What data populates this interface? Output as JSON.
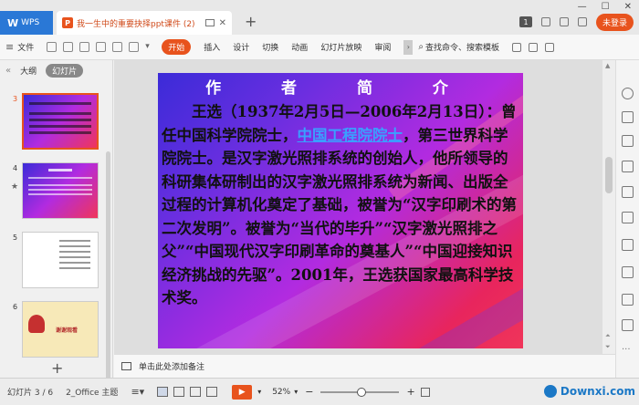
{
  "titlebar": {
    "app_tab": "WPS",
    "doc_tab": "我一生中的重要抉择ppt课件 (2)",
    "login": "未登录",
    "badge": "1",
    "new_tab": "+"
  },
  "ribbon": {
    "file": "文件",
    "start": "开始",
    "tabs": [
      "插入",
      "设计",
      "切换",
      "动画",
      "幻灯片放映",
      "审阅"
    ],
    "search": "查找命令、搜索模板"
  },
  "leftpanel": {
    "outline_tab": "大纲",
    "slides_tab": "幻灯片",
    "thumbs": [
      {
        "num": "3",
        "active": true
      },
      {
        "num": "4",
        "active": false
      },
      {
        "num": "5",
        "active": false
      },
      {
        "num": "6",
        "active": false
      }
    ],
    "thumb6_text": "谢谢观看"
  },
  "slide": {
    "title": "作 者 简 介",
    "body_pre": "王选（1937年2月5日—2006年2月13日）：曾任中国科学院院士，",
    "body_link": "中国工程院院士",
    "body_post": "，第三世界科学院院士。是汉字激光照排系统的创始人，他所领导的科研集体研制出的汉字激光照排系统为新闻、出版全过程的计算机化奠定了基础，被誉为“汉字印刷术的第二次发明”。被誉为“当代的毕升”“汉字激光照排之父”“中国现代汉字印刷革命的奠基人”“中国迎接知识经济挑战的先驱”。2001年，王选获国家最高科学技术奖。"
  },
  "notes": {
    "placeholder": "单击此处添加备注"
  },
  "statusbar": {
    "slide_count": "幻灯片 3 / 6",
    "theme": "2_Office 主题",
    "zoom": "52%",
    "zoom_value": 0.52
  },
  "watermark": "Downxi.com",
  "colors": {
    "accent": "#e8531d",
    "slide_gradient_start": "#3b2bd8",
    "slide_gradient_end": "#f0355a"
  }
}
